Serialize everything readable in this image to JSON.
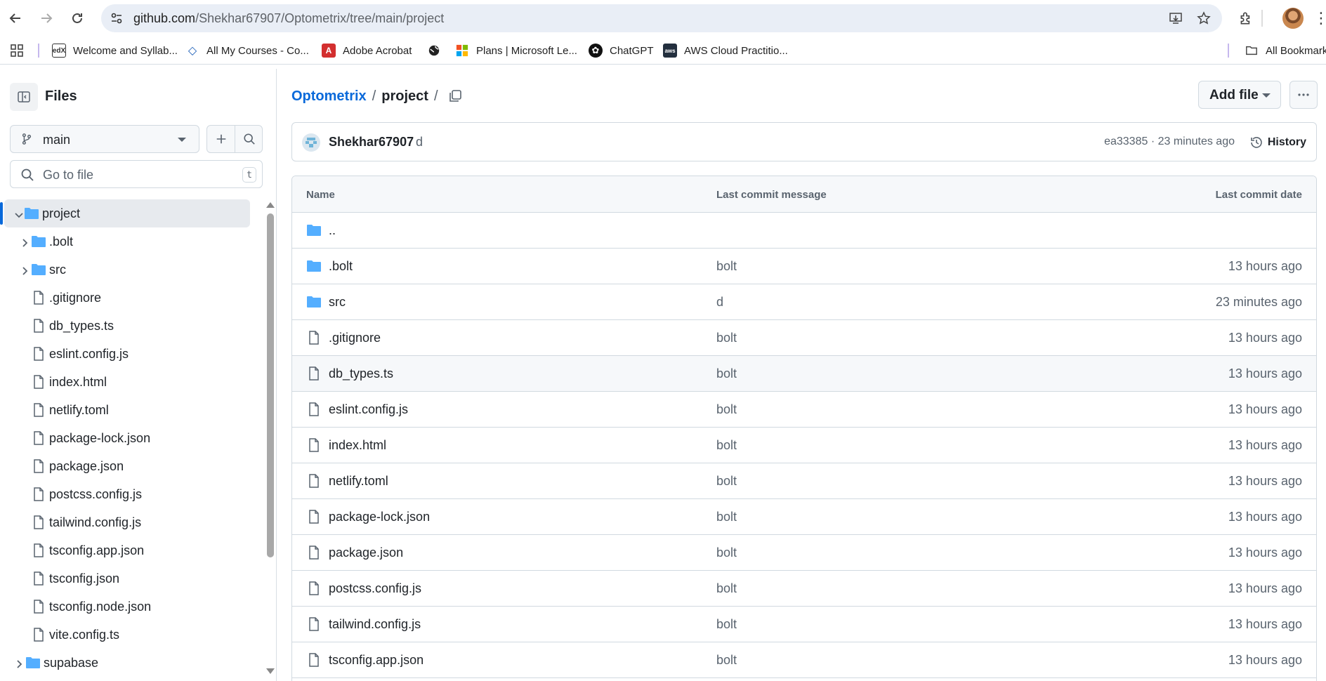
{
  "browser": {
    "url_host": "github.com",
    "url_path": "/Shekhar67907/Optometrix/tree/main/project",
    "bookmarks": [
      {
        "label": "Welcome and Syllab..."
      },
      {
        "label": "All My Courses - Co..."
      },
      {
        "label": "Adobe Acrobat"
      },
      {
        "label": ""
      },
      {
        "label": "Plans | Microsoft Le..."
      },
      {
        "label": "ChatGPT"
      },
      {
        "label": "AWS Cloud Practitio..."
      }
    ],
    "all_bookmarks": "All Bookmarks"
  },
  "sidebar": {
    "title": "Files",
    "branch": "main",
    "search_placeholder": "Go to file",
    "search_shortcut": "t",
    "tree": [
      {
        "label": "project",
        "type": "folder",
        "expanded": true,
        "level": 0
      },
      {
        "label": ".bolt",
        "type": "folder",
        "expanded": false,
        "level": 1
      },
      {
        "label": "src",
        "type": "folder",
        "expanded": false,
        "level": 1
      },
      {
        "label": ".gitignore",
        "type": "file",
        "level": 1
      },
      {
        "label": "db_types.ts",
        "type": "file",
        "level": 1
      },
      {
        "label": "eslint.config.js",
        "type": "file",
        "level": 1
      },
      {
        "label": "index.html",
        "type": "file",
        "level": 1
      },
      {
        "label": "netlify.toml",
        "type": "file",
        "level": 1
      },
      {
        "label": "package-lock.json",
        "type": "file",
        "level": 1
      },
      {
        "label": "package.json",
        "type": "file",
        "level": 1
      },
      {
        "label": "postcss.config.js",
        "type": "file",
        "level": 1
      },
      {
        "label": "tailwind.config.js",
        "type": "file",
        "level": 1
      },
      {
        "label": "tsconfig.app.json",
        "type": "file",
        "level": 1
      },
      {
        "label": "tsconfig.json",
        "type": "file",
        "level": 1
      },
      {
        "label": "tsconfig.node.json",
        "type": "file",
        "level": 1
      },
      {
        "label": "vite.config.ts",
        "type": "file",
        "level": 1
      },
      {
        "label": "supabase",
        "type": "folder",
        "expanded": false,
        "level": 0
      }
    ]
  },
  "main": {
    "breadcrumb_repo": "Optometrix",
    "breadcrumb_sep": "/",
    "breadcrumb_current": "project",
    "breadcrumb_trail": "/",
    "add_file_label": "Add file",
    "commit": {
      "author": "Shekhar67907",
      "message": "d",
      "sha_time": "ea33385 · 23 minutes ago",
      "history_label": "History"
    },
    "columns": {
      "name": "Name",
      "message": "Last commit message",
      "date": "Last commit date"
    },
    "rows": [
      {
        "name": "..",
        "type": "folder",
        "message": "",
        "date": ""
      },
      {
        "name": ".bolt",
        "type": "folder",
        "message": "bolt",
        "date": "13 hours ago"
      },
      {
        "name": "src",
        "type": "folder",
        "message": "d",
        "date": "23 minutes ago"
      },
      {
        "name": ".gitignore",
        "type": "file",
        "message": "bolt",
        "date": "13 hours ago"
      },
      {
        "name": "db_types.ts",
        "type": "file",
        "message": "bolt",
        "date": "13 hours ago"
      },
      {
        "name": "eslint.config.js",
        "type": "file",
        "message": "bolt",
        "date": "13 hours ago"
      },
      {
        "name": "index.html",
        "type": "file",
        "message": "bolt",
        "date": "13 hours ago"
      },
      {
        "name": "netlify.toml",
        "type": "file",
        "message": "bolt",
        "date": "13 hours ago"
      },
      {
        "name": "package-lock.json",
        "type": "file",
        "message": "bolt",
        "date": "13 hours ago"
      },
      {
        "name": "package.json",
        "type": "file",
        "message": "bolt",
        "date": "13 hours ago"
      },
      {
        "name": "postcss.config.js",
        "type": "file",
        "message": "bolt",
        "date": "13 hours ago"
      },
      {
        "name": "tailwind.config.js",
        "type": "file",
        "message": "bolt",
        "date": "13 hours ago"
      },
      {
        "name": "tsconfig.app.json",
        "type": "file",
        "message": "bolt",
        "date": "13 hours ago"
      }
    ]
  },
  "colors": {
    "link": "#0969da",
    "folder": "#54aeff",
    "border": "#d1d9e0",
    "muted": "#59636e"
  }
}
